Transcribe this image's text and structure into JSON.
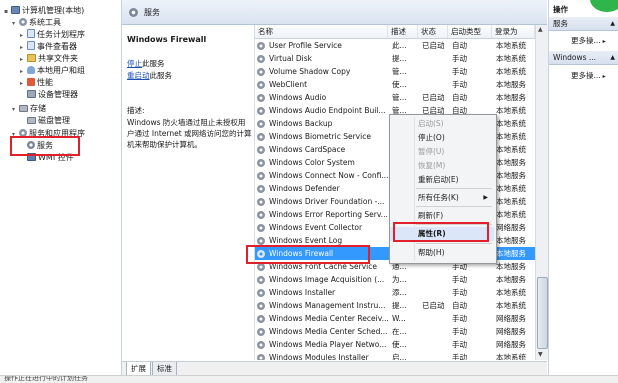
{
  "tree": {
    "items": [
      {
        "label": "计算机管理(本地)",
        "icon": "computer-icon",
        "expander": "▪",
        "depth": 0
      },
      {
        "label": "系统工具",
        "icon": "tools-icon",
        "expander": "▾",
        "depth": 1
      },
      {
        "label": "任务计划程序",
        "icon": "clock-icon",
        "expander": "▸",
        "depth": 2
      },
      {
        "label": "事件查看器",
        "icon": "event-log-icon",
        "expander": "▸",
        "depth": 2
      },
      {
        "label": "共享文件夹",
        "icon": "folder-icon",
        "expander": "▸",
        "depth": 2
      },
      {
        "label": "本地用户和组",
        "icon": "users-icon",
        "expander": "▸",
        "depth": 2
      },
      {
        "label": "性能",
        "icon": "performance-icon",
        "expander": "▸",
        "depth": 2
      },
      {
        "label": "设备管理器",
        "icon": "device-icon",
        "expander": "",
        "depth": 2
      },
      {
        "label": "存储",
        "icon": "storage-icon",
        "expander": "▾",
        "depth": 1
      },
      {
        "label": "磁盘管理",
        "icon": "disk-icon",
        "expander": "",
        "depth": 2
      },
      {
        "label": "服务和应用程序",
        "icon": "services-apps-icon",
        "expander": "▾",
        "depth": 1
      },
      {
        "label": "服务",
        "icon": "gear-icon",
        "expander": "",
        "depth": 2
      },
      {
        "label": "WMI 控件",
        "icon": "wmi-icon",
        "expander": "",
        "depth": 2
      }
    ]
  },
  "header": {
    "title": "服务"
  },
  "description": {
    "service_name": "Windows Firewall",
    "stop_link": "停止",
    "stop_suffix": "此服务",
    "restart_link": "重启动",
    "restart_suffix": "此服务",
    "desc_label": "描述:",
    "desc_text": "Windows 防火墙通过阻止未授权用户通过 Internet 或网络访问您的计算机来帮助保护计算机。"
  },
  "columns": [
    "名称",
    "描述",
    "状态",
    "启动类型",
    "登录为"
  ],
  "services": [
    {
      "name": "User Profile Service",
      "desc": "此...",
      "status": "已启动",
      "startup": "自动",
      "logon": "本地系统"
    },
    {
      "name": "Virtual Disk",
      "desc": "提...",
      "status": "",
      "startup": "手动",
      "logon": "本地系统"
    },
    {
      "name": "Volume Shadow Copy",
      "desc": "管...",
      "status": "",
      "startup": "手动",
      "logon": "本地系统"
    },
    {
      "name": "WebClient",
      "desc": "使...",
      "status": "",
      "startup": "手动",
      "logon": "本地服务"
    },
    {
      "name": "Windows Audio",
      "desc": "管...",
      "status": "已启动",
      "startup": "自动",
      "logon": "本地服务"
    },
    {
      "name": "Windows Audio Endpoint Buil...",
      "desc": "管...",
      "status": "已启动",
      "startup": "自动",
      "logon": "本地系统"
    },
    {
      "name": "Windows Backup",
      "desc": "提...",
      "status": "",
      "startup": "手动",
      "logon": "本地系统"
    },
    {
      "name": "Windows Biometric Service",
      "desc": "W...",
      "status": "",
      "startup": "手动",
      "logon": "本地系统"
    },
    {
      "name": "Windows CardSpace",
      "desc": "安...",
      "status": "",
      "startup": "手动",
      "logon": "本地系统"
    },
    {
      "name": "Windows Color System",
      "desc": "W...",
      "status": "",
      "startup": "手动",
      "logon": "本地服务"
    },
    {
      "name": "Windows Connect Now - Confi...",
      "desc": "W...",
      "status": "",
      "startup": "手动",
      "logon": "本地服务"
    },
    {
      "name": "Windows Defender",
      "desc": "保...",
      "status": "",
      "startup": "手动",
      "logon": "本地系统"
    },
    {
      "name": "Windows Driver Foundation -...",
      "desc": "管...",
      "status": "",
      "startup": "手动",
      "logon": "本地系统"
    },
    {
      "name": "Windows Error Reporting Serv...",
      "desc": "允...",
      "status": "",
      "startup": "手动",
      "logon": "本地系统"
    },
    {
      "name": "Windows Event Collector",
      "desc": "此...",
      "status": "",
      "startup": "手动",
      "logon": "网络服务"
    },
    {
      "name": "Windows Event Log",
      "desc": "此...",
      "status": "已启动",
      "startup": "自动",
      "logon": "本地服务"
    },
    {
      "name": "Windows Firewall",
      "desc": "W...",
      "status": "已启动",
      "startup": "自动",
      "logon": "本地服务"
    },
    {
      "name": "Windows Font Cache Service",
      "desc": "通...",
      "status": "",
      "startup": "手动",
      "logon": "本地服务"
    },
    {
      "name": "Windows Image Acquisition (...",
      "desc": "为...",
      "status": "",
      "startup": "手动",
      "logon": "本地服务"
    },
    {
      "name": "Windows Installer",
      "desc": "添...",
      "status": "",
      "startup": "手动",
      "logon": "本地系统"
    },
    {
      "name": "Windows Management Instru...",
      "desc": "提...",
      "status": "已启动",
      "startup": "自动",
      "logon": "本地系统"
    },
    {
      "name": "Windows Media Center Receiv...",
      "desc": "W...",
      "status": "",
      "startup": "手动",
      "logon": "网络服务"
    },
    {
      "name": "Windows Media Center Sched...",
      "desc": "在...",
      "status": "",
      "startup": "手动",
      "logon": "网络服务"
    },
    {
      "name": "Windows Media Player Netwo...",
      "desc": "使...",
      "status": "",
      "startup": "手动",
      "logon": "网络服务"
    },
    {
      "name": "Windows Modules Installer",
      "desc": "启...",
      "status": "",
      "startup": "手动",
      "logon": "本地系统"
    }
  ],
  "context_menu": {
    "items": [
      {
        "label": "启动(S)",
        "disabled": true
      },
      {
        "label": "停止(O)",
        "disabled": false
      },
      {
        "label": "暂停(U)",
        "disabled": true
      },
      {
        "label": "恢复(M)",
        "disabled": true
      },
      {
        "label": "重新启动(E)",
        "disabled": false
      },
      {
        "label": "所有任务(K)",
        "disabled": false,
        "submenu": true
      },
      {
        "label": "刷新(F)",
        "disabled": false
      },
      {
        "label": "属性(R)",
        "disabled": false,
        "highlight": true,
        "bold": true
      },
      {
        "label": "帮助(H)",
        "disabled": false
      }
    ]
  },
  "tabs": [
    "扩展",
    "标准"
  ],
  "status_bar": "操作正在进行中的计划任务",
  "actions": {
    "title": "操作",
    "section1": "服务",
    "more1": "更多操...",
    "section2": "Windows ...",
    "more2": "更多操..."
  },
  "colors": {
    "selection": "#3399ff",
    "annotation": "#e0202a",
    "badge": "#2fb64a"
  }
}
